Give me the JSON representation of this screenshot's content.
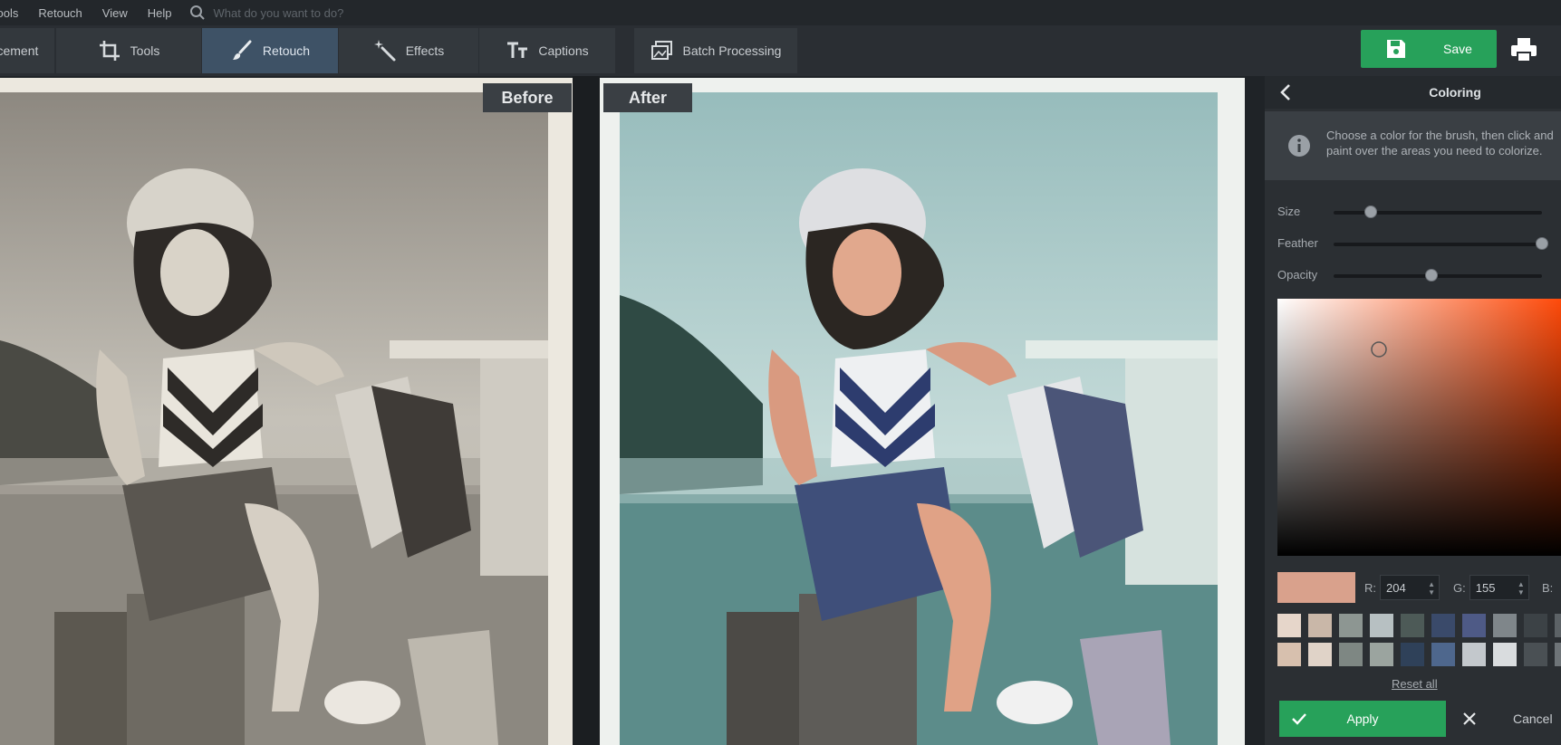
{
  "menu": {
    "items": [
      "Tools",
      "Retouch",
      "View",
      "Help"
    ],
    "search_placeholder": "What do you want to do?"
  },
  "toolbar": {
    "tabs": [
      {
        "label": "Enhancement",
        "icon": "enhancement-icon"
      },
      {
        "label": "Tools",
        "icon": "crop-icon"
      },
      {
        "label": "Retouch",
        "icon": "brush-icon"
      },
      {
        "label": "Effects",
        "icon": "magic-wand-icon"
      },
      {
        "label": "Captions",
        "icon": "text-icon"
      },
      {
        "label": "Batch Processing",
        "icon": "batch-icon"
      }
    ],
    "active_tab": "Retouch",
    "save_label": "Save",
    "print_icon": "printer-icon"
  },
  "viewer": {
    "before_label": "Before",
    "after_label": "After"
  },
  "panel": {
    "title": "Coloring",
    "info_line1": "Choose a color for the brush, then click and",
    "info_line2": "paint over the areas you need to colorize.",
    "sliders": [
      {
        "label": "Size",
        "value": 0.18
      },
      {
        "label": "Feather",
        "value": 1.0
      },
      {
        "label": "Opacity",
        "value": 0.47
      }
    ],
    "rgb": {
      "r_label": "R:",
      "r": "204",
      "g_label": "G:",
      "g": "155",
      "b_label": "B:",
      "b": ""
    },
    "current_color": "#d9a18c",
    "palette_row1": [
      "#e6d6ca",
      "#c9b7a8",
      "#8d9692",
      "#b7c0c2",
      "#4d5a57",
      "#3a4a6a",
      "#4e5a86",
      "#7f868a",
      "#3c4246",
      "#5c6266"
    ],
    "palette_row2": [
      "#d7c0ae",
      "#e0d3c8",
      "#7e8783",
      "#9ba49f",
      "#2f4159",
      "#4e678d",
      "#c3c8cc",
      "#d9dcde",
      "#4a5054",
      "#6e7478"
    ],
    "reset_label": "Reset all",
    "apply_label": "Apply",
    "cancel_label": "Cancel"
  }
}
